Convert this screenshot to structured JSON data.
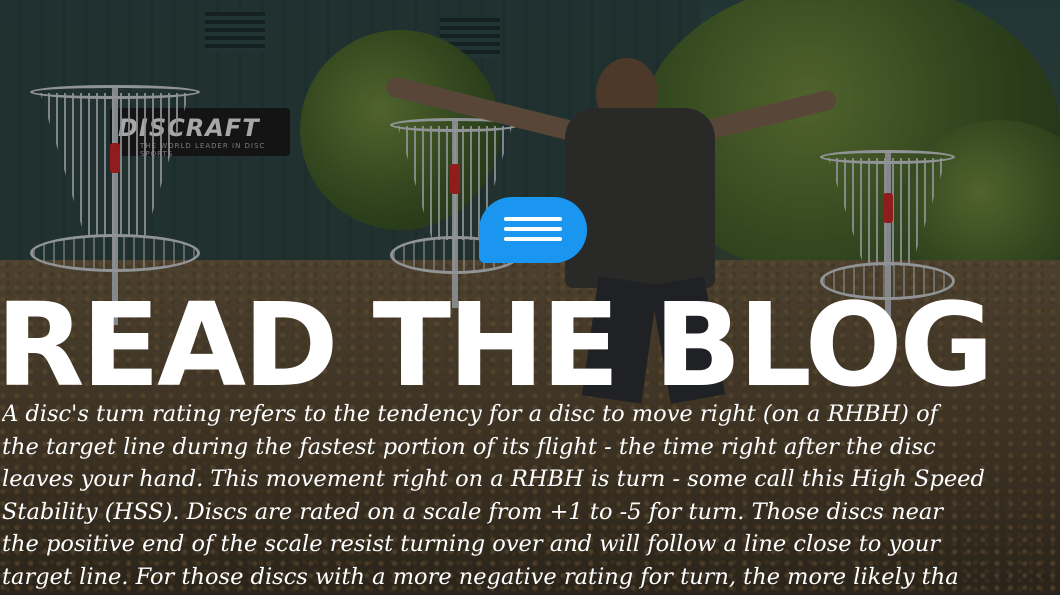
{
  "hero": {
    "sign_logo": "DISCRAFT",
    "sign_tagline": "THE WORLD LEADER IN DISC SPORTS"
  },
  "menu": {
    "icon": "hamburger-menu-icon",
    "accent_color": "#1a96f0"
  },
  "heading": "READ THE BLOG",
  "paragraph_lines": [
    "A disc's turn rating refers to the tendency for a disc to move right (on a RHBH) of",
    "the target line during the fastest portion of its flight - the time right after the disc",
    "leaves your hand. This movement right on a RHBH is turn - some call this High Speed",
    "Stability (HSS). Discs are rated on a scale from +1 to -5 for turn. Those discs near",
    "the positive end of the scale resist turning over and will follow a line close to your",
    "target line. For those discs with a more negative rating for turn, the more likely tha"
  ]
}
